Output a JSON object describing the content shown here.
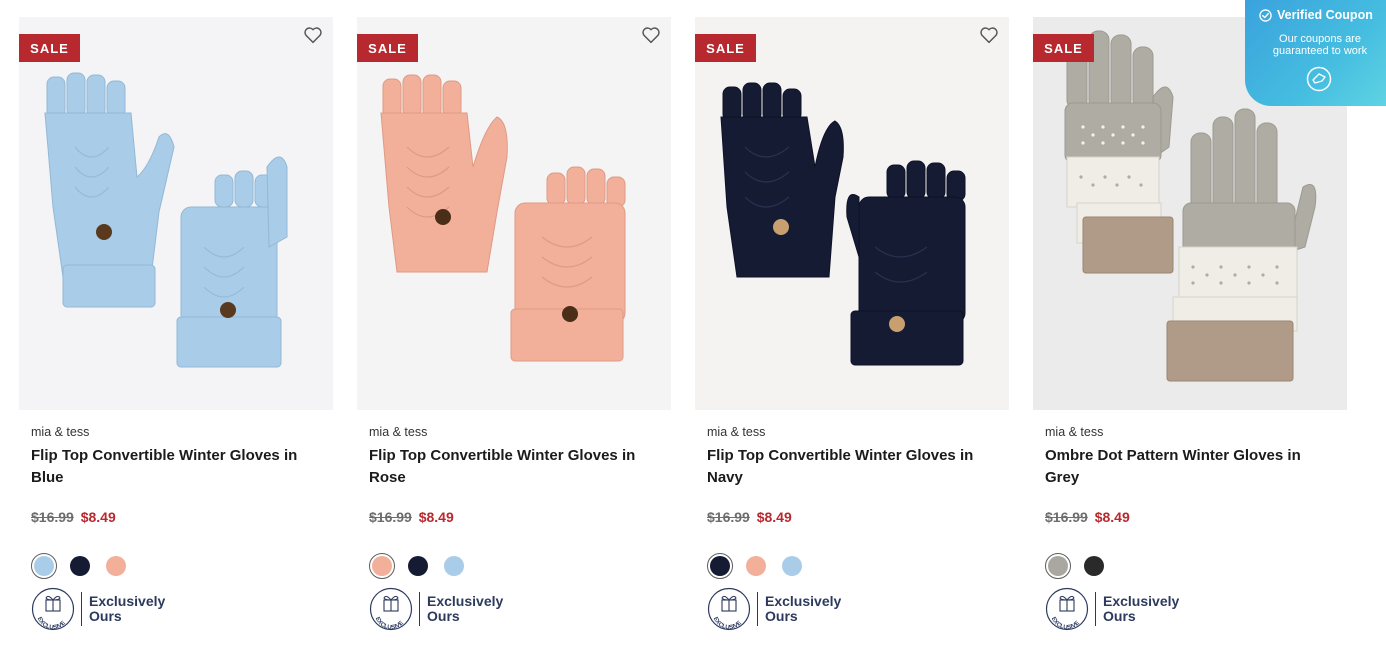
{
  "coupon": {
    "title": "Verified Coupon",
    "line1": "Our coupons are",
    "line2": "guaranteed to work",
    "check_icon": "check-circle-icon",
    "logo_icon": "coupon-cap-icon"
  },
  "colors": {
    "sale_badge": "#b8292f",
    "sale_price": "#b8292f",
    "exclusive_navy": "#2c3a5e",
    "coupon_blue": "#3aa2dd"
  },
  "products": [
    {
      "badge": "SALE",
      "brand": "mia & tess",
      "title_line1": "Flip Top Convertible Winter Gloves in",
      "title_line2": "Blue",
      "price_original": "$16.99",
      "price_sale": "$8.49",
      "swatches": [
        {
          "color": "#a9cde8",
          "selected": true
        },
        {
          "color": "#151b33",
          "selected": false
        },
        {
          "color": "#f2b09a",
          "selected": false
        }
      ],
      "exclusive_line1": "Exclusively",
      "exclusive_line2": "Ours",
      "exclusive_badge_text": "EXCLUSIVE"
    },
    {
      "badge": "SALE",
      "brand": "mia & tess",
      "title_line1": "Flip Top Convertible Winter Gloves in",
      "title_line2": "Rose",
      "price_original": "$16.99",
      "price_sale": "$8.49",
      "swatches": [
        {
          "color": "#f2b09a",
          "selected": true
        },
        {
          "color": "#151b33",
          "selected": false
        },
        {
          "color": "#a9cde8",
          "selected": false
        }
      ],
      "exclusive_line1": "Exclusively",
      "exclusive_line2": "Ours",
      "exclusive_badge_text": "EXCLUSIVE"
    },
    {
      "badge": "SALE",
      "brand": "mia & tess",
      "title_line1": "Flip Top Convertible Winter Gloves in",
      "title_line2": "Navy",
      "price_original": "$16.99",
      "price_sale": "$8.49",
      "swatches": [
        {
          "color": "#151b33",
          "selected": true
        },
        {
          "color": "#f2b09a",
          "selected": false
        },
        {
          "color": "#a9cde8",
          "selected": false
        }
      ],
      "exclusive_line1": "Exclusively",
      "exclusive_line2": "Ours",
      "exclusive_badge_text": "EXCLUSIVE"
    },
    {
      "badge": "SALE",
      "brand": "mia & tess",
      "title_line1": "Ombre Dot Pattern Winter Gloves in",
      "title_line2": "Grey",
      "price_original": "$16.99",
      "price_sale": "$8.49",
      "swatches": [
        {
          "color": "#a9a79f",
          "selected": true
        },
        {
          "color": "#2a2a2a",
          "selected": false
        }
      ],
      "exclusive_line1": "Exclusively",
      "exclusive_line2": "Ours",
      "exclusive_badge_text": "EXCLUSIVE"
    }
  ]
}
